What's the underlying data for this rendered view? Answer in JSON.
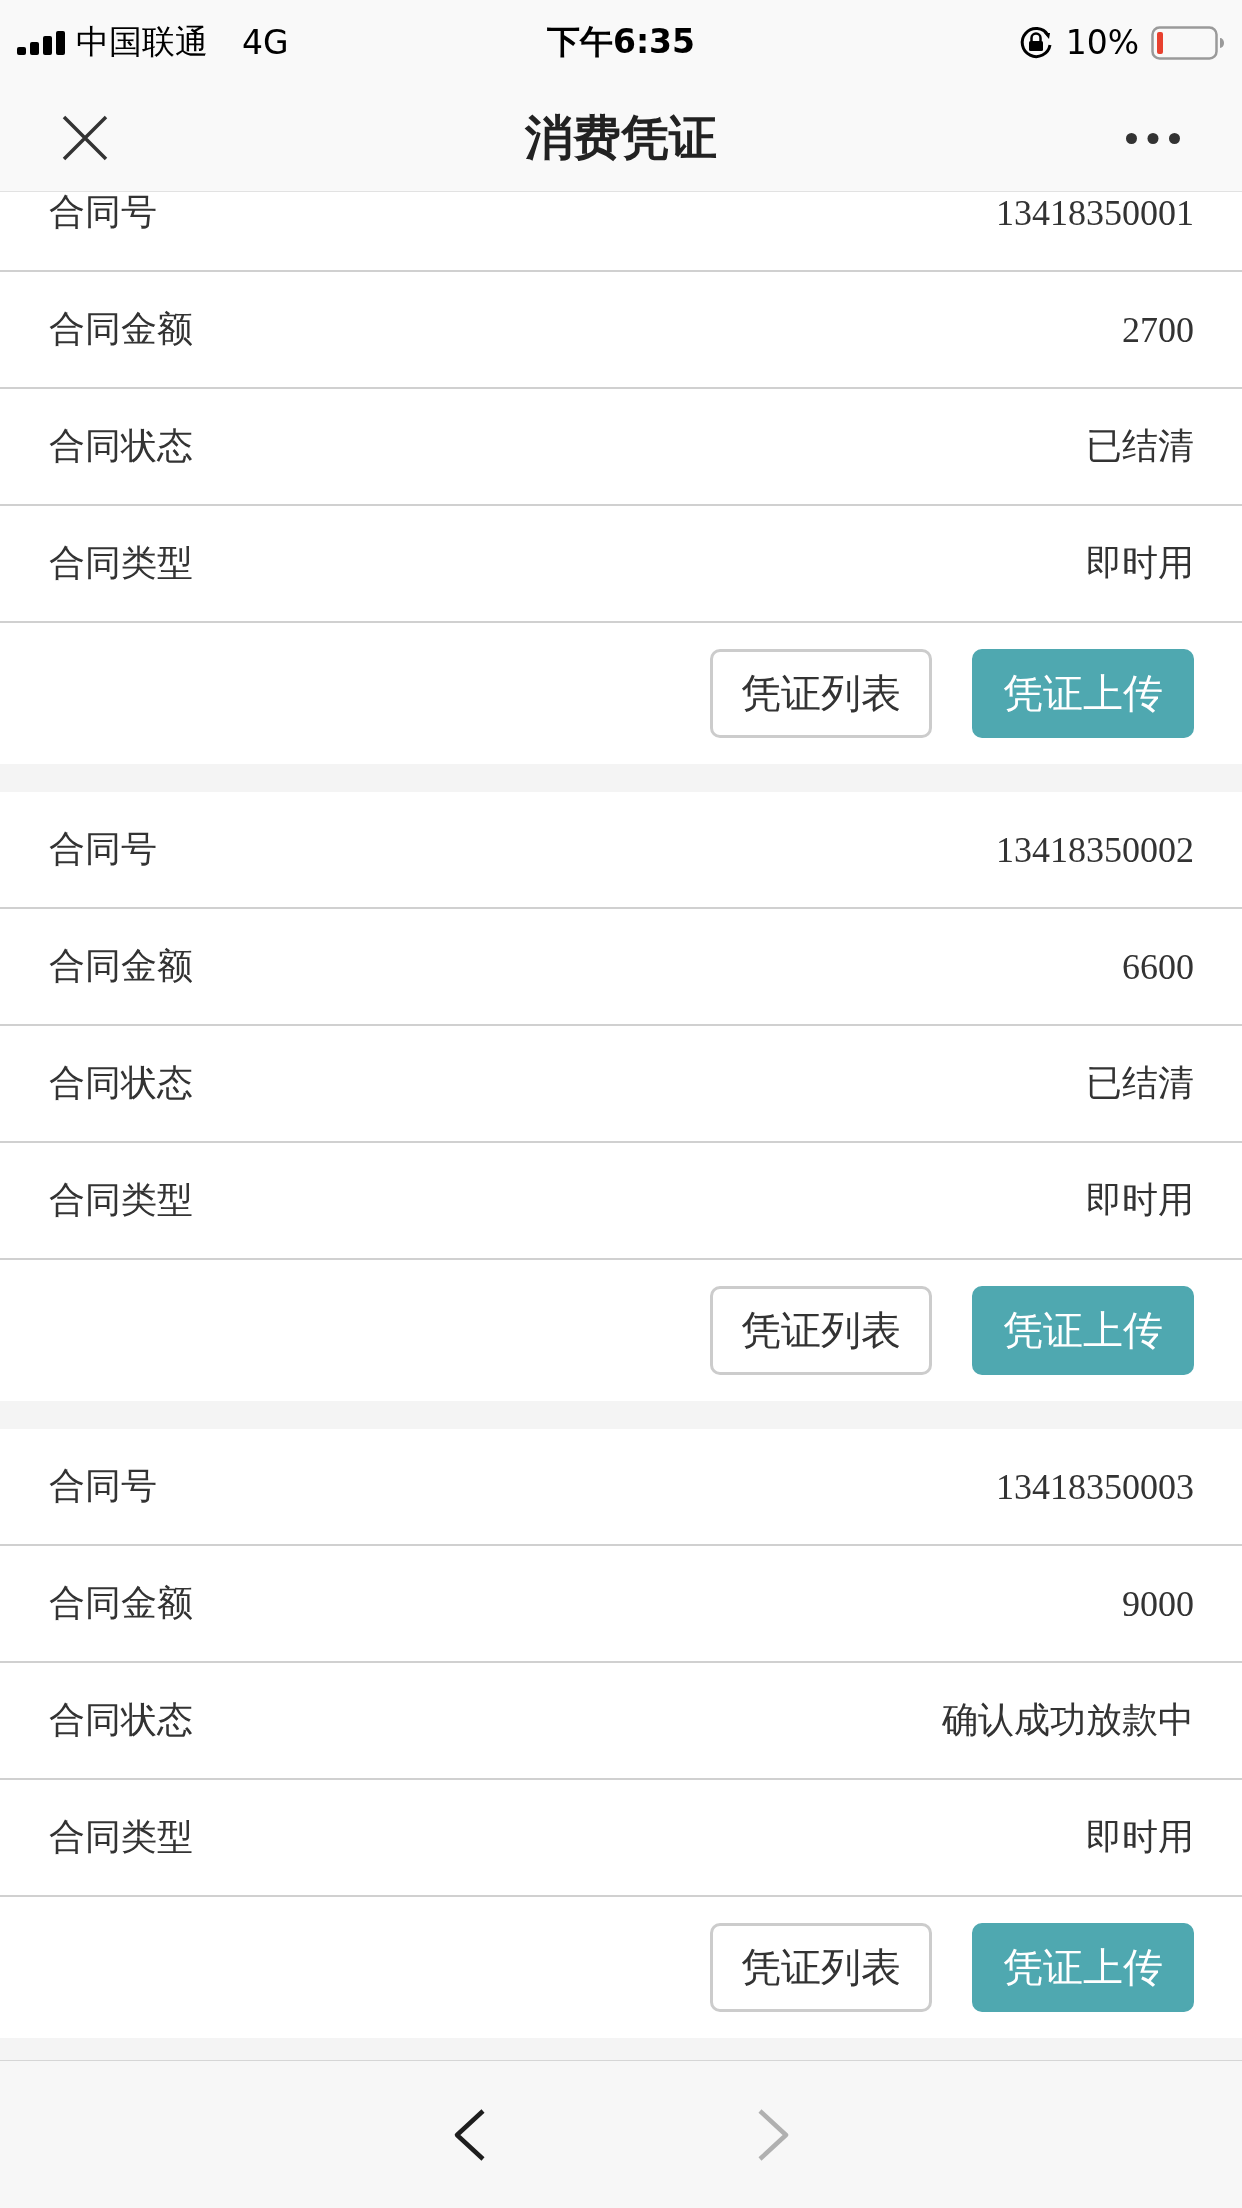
{
  "status_bar": {
    "carrier": "中国联通",
    "network": "4G",
    "time": "下午6:35",
    "battery": "10%"
  },
  "nav_bar": {
    "title": "消费凭证"
  },
  "contracts": [
    {
      "rows": [
        {
          "label": "合同号",
          "value": "13418350001"
        },
        {
          "label": "合同金额",
          "value": "2700"
        },
        {
          "label": "合同状态",
          "value": "已结清"
        },
        {
          "label": "合同类型",
          "value": "即时用"
        }
      ],
      "buttons": [
        {
          "label": "凭证列表",
          "kind": "outline"
        },
        {
          "label": "凭证上传",
          "kind": "primary"
        }
      ]
    },
    {
      "rows": [
        {
          "label": "合同号",
          "value": "13418350002"
        },
        {
          "label": "合同金额",
          "value": "6600"
        },
        {
          "label": "合同状态",
          "value": "已结清"
        },
        {
          "label": "合同类型",
          "value": "即时用"
        }
      ],
      "buttons": [
        {
          "label": "凭证列表",
          "kind": "outline"
        },
        {
          "label": "凭证上传",
          "kind": "primary"
        }
      ]
    },
    {
      "rows": [
        {
          "label": "合同号",
          "value": "13418350003"
        },
        {
          "label": "合同金额",
          "value": "9000"
        },
        {
          "label": "合同状态",
          "value": "确认成功放款中"
        },
        {
          "label": "合同类型",
          "value": "即时用"
        }
      ],
      "buttons": [
        {
          "label": "凭证列表",
          "kind": "outline"
        },
        {
          "label": "凭证上传",
          "kind": "primary"
        }
      ]
    }
  ],
  "toolbar": {
    "back": {
      "disabled": false
    },
    "forward": {
      "disabled": true
    }
  }
}
